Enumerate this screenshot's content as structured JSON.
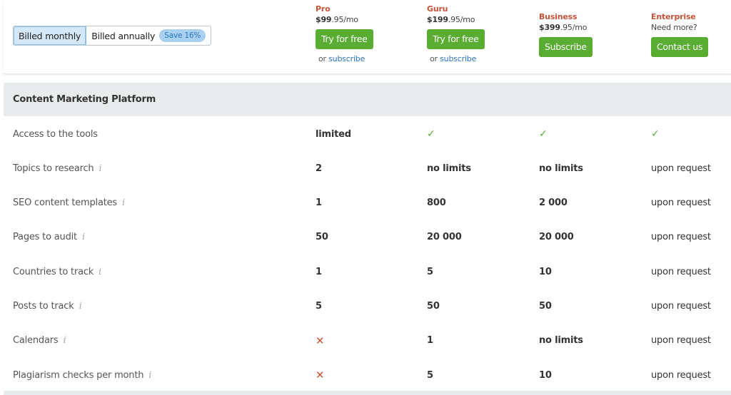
{
  "billing": {
    "monthly_label": "Billed monthly",
    "annually_label": "Billed annually",
    "save_badge": "Save 16%",
    "selected": "monthly"
  },
  "plans": [
    {
      "name": "Pro",
      "price_main": "$99",
      "price_rest": ".95/mo",
      "button": "Try for free",
      "sub_prefix": "or",
      "sub_link": "subscribe"
    },
    {
      "name": "Guru",
      "price_main": "$199",
      "price_rest": ".95/mo",
      "button": "Try for free",
      "sub_prefix": "or",
      "sub_link": "subscribe"
    },
    {
      "name": "Business",
      "price_main": "$399",
      "price_rest": ".95/mo",
      "button": "Subscribe"
    },
    {
      "name": "Enterprise",
      "tagline": "Need more?",
      "button": "Contact us"
    }
  ],
  "colors": {
    "accent_green": "#58ad32",
    "plan_name_red": "#c4553a",
    "link_blue": "#2a76c0",
    "section_gray": "#e9eced"
  },
  "section": {
    "title": "Content Marketing Platform",
    "info_icon": "i",
    "rows": [
      {
        "feature": "Access to the tools",
        "info": false,
        "values": [
          {
            "type": "text",
            "text": "limited",
            "bold": true
          },
          {
            "type": "check",
            "text": "✓"
          },
          {
            "type": "check",
            "text": "✓"
          },
          {
            "type": "check",
            "text": "✓"
          }
        ]
      },
      {
        "feature": "Topics to research",
        "info": true,
        "values": [
          {
            "type": "text",
            "text": "2",
            "bold": true
          },
          {
            "type": "text",
            "text": "no limits",
            "bold": true
          },
          {
            "type": "text",
            "text": "no limits",
            "bold": true
          },
          {
            "type": "text",
            "text": "upon request",
            "bold": false
          }
        ]
      },
      {
        "feature": "SEO content templates",
        "info": true,
        "values": [
          {
            "type": "text",
            "text": "1",
            "bold": true
          },
          {
            "type": "text",
            "text": "800",
            "bold": true
          },
          {
            "type": "text",
            "text": "2 000",
            "bold": true
          },
          {
            "type": "text",
            "text": "upon request",
            "bold": false
          }
        ]
      },
      {
        "feature": "Pages to audit",
        "info": true,
        "values": [
          {
            "type": "text",
            "text": "50",
            "bold": true
          },
          {
            "type": "text",
            "text": "20 000",
            "bold": true
          },
          {
            "type": "text",
            "text": "20 000",
            "bold": true
          },
          {
            "type": "text",
            "text": "upon request",
            "bold": false
          }
        ]
      },
      {
        "feature": "Countries to track",
        "info": true,
        "values": [
          {
            "type": "text",
            "text": "1",
            "bold": true
          },
          {
            "type": "text",
            "text": "5",
            "bold": true
          },
          {
            "type": "text",
            "text": "10",
            "bold": true
          },
          {
            "type": "text",
            "text": "upon request",
            "bold": false
          }
        ]
      },
      {
        "feature": "Posts to track",
        "info": true,
        "values": [
          {
            "type": "text",
            "text": "5",
            "bold": true
          },
          {
            "type": "text",
            "text": "50",
            "bold": true
          },
          {
            "type": "text",
            "text": "50",
            "bold": true
          },
          {
            "type": "text",
            "text": "upon request",
            "bold": false
          }
        ]
      },
      {
        "feature": "Calendars",
        "info": true,
        "values": [
          {
            "type": "cross",
            "text": "✕"
          },
          {
            "type": "text",
            "text": "1",
            "bold": true
          },
          {
            "type": "text",
            "text": "no limits",
            "bold": true
          },
          {
            "type": "text",
            "text": "upon request",
            "bold": false
          }
        ]
      },
      {
        "feature": "Plagiarism checks per month",
        "info": true,
        "values": [
          {
            "type": "cross",
            "text": "✕"
          },
          {
            "type": "text",
            "text": "5",
            "bold": true
          },
          {
            "type": "text",
            "text": "10",
            "bold": true
          },
          {
            "type": "text",
            "text": "upon request",
            "bold": false
          }
        ]
      }
    ]
  }
}
